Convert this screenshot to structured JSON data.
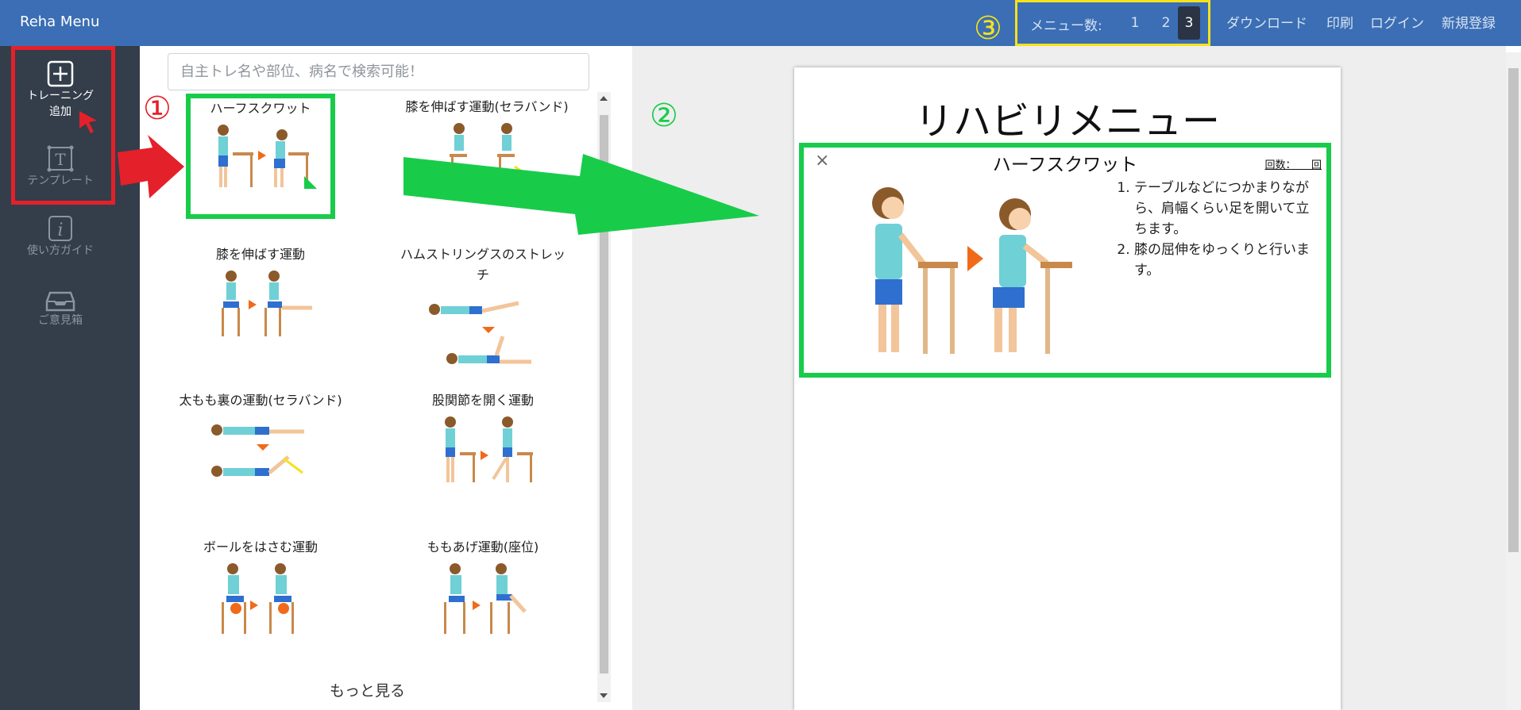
{
  "app": {
    "brand": "Reha Menu"
  },
  "topnav": {
    "menu_count_label": "メニュー数:",
    "menu_counts": [
      "1",
      "2",
      "3"
    ],
    "active_count": "3",
    "links": {
      "download": "ダウンロード",
      "print": "印刷",
      "login": "ログイン",
      "register": "新規登録"
    }
  },
  "sidebar": {
    "items": [
      {
        "label_line1": "トレーニング",
        "label_line2": "追加",
        "icon": "plus-square-icon"
      },
      {
        "label": "テンプレート",
        "icon": "template-icon"
      },
      {
        "label": "使い方ガイド",
        "icon": "info-icon"
      },
      {
        "label": "ご意見箱",
        "icon": "inbox-icon"
      }
    ]
  },
  "search": {
    "placeholder": "自主トレ名や部位、病名で検索可能！"
  },
  "exercises": [
    {
      "title": "ハーフスクワット"
    },
    {
      "title": "膝を伸ばす運動(セラバンド)"
    },
    {
      "title": "膝を伸ばす運動"
    },
    {
      "title": "ハムストリングスのストレッチ"
    },
    {
      "title": "太もも裏の運動(セラバンド)"
    },
    {
      "title": "股関節を開く運動"
    },
    {
      "title": "ボールをはさむ運動"
    },
    {
      "title": "ももあげ運動(座位)"
    }
  ],
  "list": {
    "more_label": "もっと見る"
  },
  "preview": {
    "page_title": "リハビリメニュー",
    "entry": {
      "close": "×",
      "name": "ハーフスクワット",
      "reps_label": "回数：　　回",
      "steps": [
        "テーブルなどにつかまりながら、肩幅くらい足を開いて立ちます。",
        "膝の屈伸をゆっくりと行います。"
      ]
    }
  },
  "annotations": {
    "one": "①",
    "two": "②",
    "three": "③"
  },
  "colors": {
    "nav": "#3b6eb4",
    "sidebar": "#343d4a",
    "highlight_green": "#18cc4a",
    "highlight_red": "#e4202a",
    "highlight_yellow": "#f5e21c"
  }
}
